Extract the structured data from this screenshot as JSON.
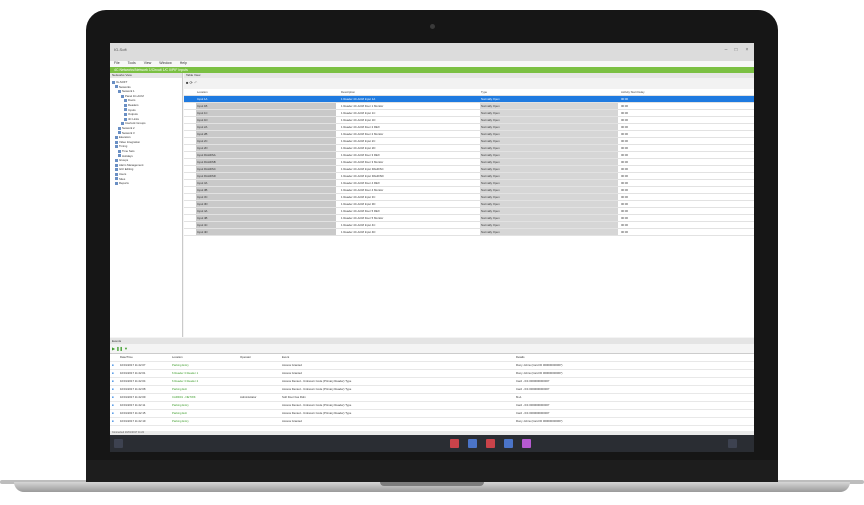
{
  "app": {
    "title": "IG-Soft",
    "menu": [
      "File",
      "Tools",
      "View",
      "Window",
      "Help"
    ],
    "path": "4C Networks/Network 1/Circuit 1/C 0/PIF Inputs"
  },
  "left_panel": {
    "title": "Networks View",
    "tree": [
      "IG-SOFT",
      "Networks",
      "Network 1",
      "Panel 4C-ACM",
      "Doors",
      "Readers",
      "Inputs",
      "Outputs",
      "4C Links",
      "Interlock Groups",
      "Network 2",
      "Network 3",
      "Elevators",
      "Video Integration",
      "Timing",
      "Time Sets",
      "Holidays",
      "Groups",
      "Alarm Management",
      "GUI Editing",
      "Users",
      "Sites",
      "Reports"
    ]
  },
  "grid": {
    "panel_title": "Table View",
    "columns": [
      "Location",
      "Description",
      "Type",
      "Activity Start Delay"
    ],
    "rows": [
      [
        "Input 1A",
        "1 Reader 4C-ACM Input 1A",
        "Normally Open",
        "00:00"
      ],
      [
        "Input 1B",
        "1 Reader 4C-ACM Door 1 Monitor",
        "Normally Open",
        "00:00"
      ],
      [
        "Input 1C",
        "1 Reader 4C-ACM Input 1C",
        "Normally Open",
        "00:00"
      ],
      [
        "Input 1D",
        "1 Reader 4C-ACM Input 1D",
        "Normally Open",
        "00:00"
      ],
      [
        "Input 2A",
        "1 Reader 4C-ACM Door 2 REX",
        "Normally Open",
        "00:00"
      ],
      [
        "Input 2B",
        "1 Reader 4C-ACM Door 2 Monitor",
        "Normally Open",
        "00:00"
      ],
      [
        "Input 2C",
        "1 Reader 4C-ACM Input 2C",
        "Normally Open",
        "00:00"
      ],
      [
        "Input 2D",
        "1 Reader 4C-ACM Input 2D",
        "Normally Open",
        "00:00"
      ],
      [
        "Input RAHDSA",
        "1 Reader 4C-ACM Door 3 REX",
        "Normally Open",
        "00:00"
      ],
      [
        "Input RAHDSB",
        "1 Reader 4C-ACM Door 3 Monitor",
        "Normally Open",
        "00:00"
      ],
      [
        "Input RAHDSC",
        "1 Reader 4C-ACM Input RAHDSC",
        "Normally Open",
        "00:00"
      ],
      [
        "Input RAHDSD",
        "1 Reader 4C-ACM Input RAHDSD",
        "Normally Open",
        "00:00"
      ],
      [
        "Input 3A",
        "1 Reader 4C-ACM Door 4 REX",
        "Normally Open",
        "00:00"
      ],
      [
        "Input 3B",
        "1 Reader 4C-ACM Door 4 Monitor",
        "Normally Open",
        "00:00"
      ],
      [
        "Input 3C",
        "1 Reader 4C-ACM Input 3C",
        "Normally Open",
        "00:00"
      ],
      [
        "Input 3D",
        "1 Reader 4C-ACM Input 3D",
        "Normally Open",
        "00:00"
      ],
      [
        "Input 4A",
        "1 Reader 4C-ACM Door 5 REX",
        "Normally Open",
        "00:00"
      ],
      [
        "Input 4B",
        "1 Reader 4C-ACM Door 5 Monitor",
        "Normally Open",
        "00:00"
      ],
      [
        "Input 4C",
        "1 Reader 4C-ACM Input 4C",
        "Normally Open",
        "00:00"
      ],
      [
        "Input 4D",
        "1 Reader 4C-ACM Input 4D",
        "Normally Open",
        "00:00"
      ]
    ]
  },
  "events": {
    "title": "Events",
    "columns": [
      "Date/Time",
      "Location",
      "Operator",
      "Event",
      "Details"
    ],
    "rows": [
      [
        "10/01/2017 11:22:07",
        "Parking Entry",
        "",
        "Access Granted",
        "Rony Johns (Card ID 000000000007)"
      ],
      [
        "10/01/2017 11:22:01",
        "6 Reader 3 Reader 1",
        "",
        "Access Granted",
        "Rony Johns (Card ID 000000000007)"
      ],
      [
        "10/01/2017 11:22:04",
        "6 Reader 3 Reader 2",
        "",
        "Access Denied - Unknown Code (Primary Reader) Type",
        "Card - 0/4 0000000000007"
      ],
      [
        "10/01/2017 11:22:08",
        "Parking Exit",
        "",
        "Access Denied - Unknown Code (Primary Reader) Type",
        "Card - 0/4 0000000000007"
      ],
      [
        "10/01/2017 11:22:09",
        "CARD01 - NETWK",
        "Administrator",
        "Soft Door has Rdm",
        "M+1"
      ],
      [
        "10/01/2017 11:22:11",
        "Parking Entry",
        "",
        "Access Denied - Unknown Code (Primary Reader) Type",
        "Card - 0/4 0000000000007"
      ],
      [
        "10/01/2017 11:22:15",
        "Parking Exit",
        "",
        "Access Denied - Unknown Code (Primary Reader) Type",
        "Card - 0/4 0000000000007"
      ],
      [
        "10/01/2017 11:22:19",
        "Parking Entry",
        "",
        "Access Granted",
        "Rony Johns (Card ID 000000000007)"
      ]
    ]
  },
  "status": "Connected   10/01/2017  11:22",
  "colors": {
    "accent_green": "#7bc043",
    "selection_blue": "#1e7ae0",
    "taskbar": "#2a2d33"
  }
}
